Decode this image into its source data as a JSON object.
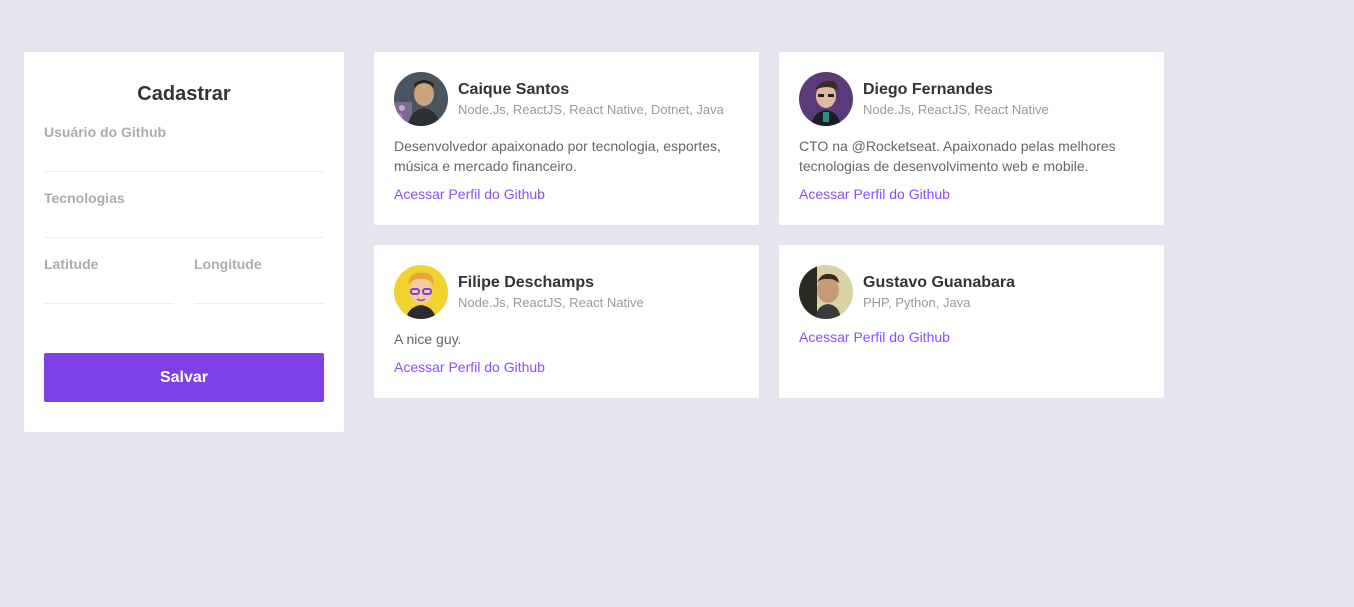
{
  "form": {
    "title": "Cadastrar",
    "github_user_label": "Usuário do Github",
    "github_user_value": "",
    "techs_label": "Tecnologias",
    "techs_value": "",
    "latitude_label": "Latitude",
    "latitude_value": "",
    "longitude_label": "Longitude",
    "longitude_value": "",
    "submit_label": "Salvar"
  },
  "devs": [
    {
      "name": "Caique Santos",
      "techs": "Node.Js, ReactJS, React Native, Dotnet, Java",
      "bio": "Desenvolvedor apaixonado por tecnologia, esportes, música e mercado financeiro.",
      "link": "Acessar Perfil do Github"
    },
    {
      "name": "Diego Fernandes",
      "techs": "Node.Js, ReactJS, React Native",
      "bio": "CTO na @Rocketseat. Apaixonado pelas melhores tecnologias de desenvolvimento web e mobile.",
      "link": "Acessar Perfil do Github"
    },
    {
      "name": "Filipe Deschamps",
      "techs": "Node.Js, ReactJS, React Native",
      "bio": "A nice guy.",
      "link": "Acessar Perfil do Github"
    },
    {
      "name": "Gustavo Guanabara",
      "techs": "PHP, Python, Java",
      "bio": "",
      "link": "Acessar Perfil do Github"
    }
  ],
  "colors": {
    "background": "#e5e6f0",
    "accent": "#7d40e7",
    "link": "#8e4dff"
  }
}
